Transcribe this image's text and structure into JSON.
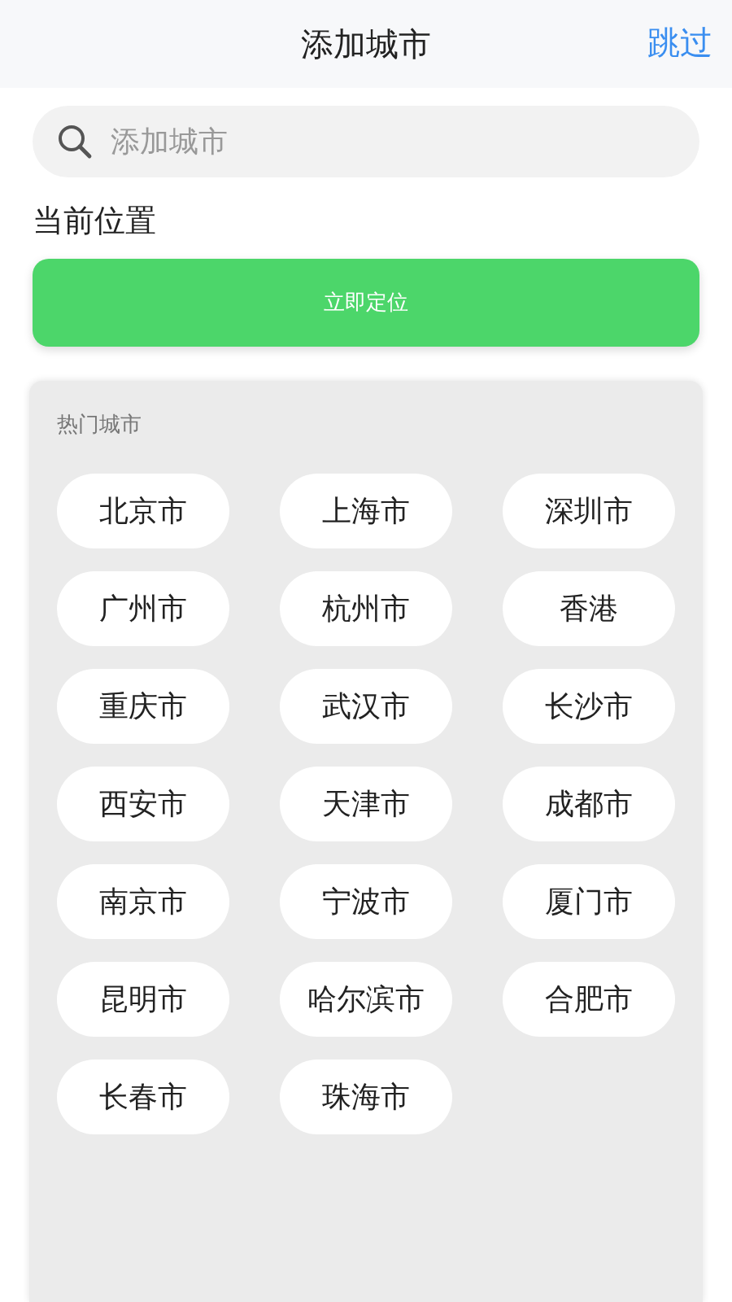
{
  "header": {
    "title": "添加城市",
    "action": "跳过"
  },
  "search": {
    "placeholder": "添加城市"
  },
  "location": {
    "label": "当前位置",
    "button": "立即定位"
  },
  "hot_cities": {
    "title": "热门城市",
    "cities": [
      "北京市",
      "上海市",
      "深圳市",
      "广州市",
      "杭州市",
      "香港",
      "重庆市",
      "武汉市",
      "长沙市",
      "西安市",
      "天津市",
      "成都市",
      "南京市",
      "宁波市",
      "厦门市",
      "昆明市",
      "哈尔滨市",
      "合肥市",
      "长春市",
      "珠海市"
    ]
  }
}
